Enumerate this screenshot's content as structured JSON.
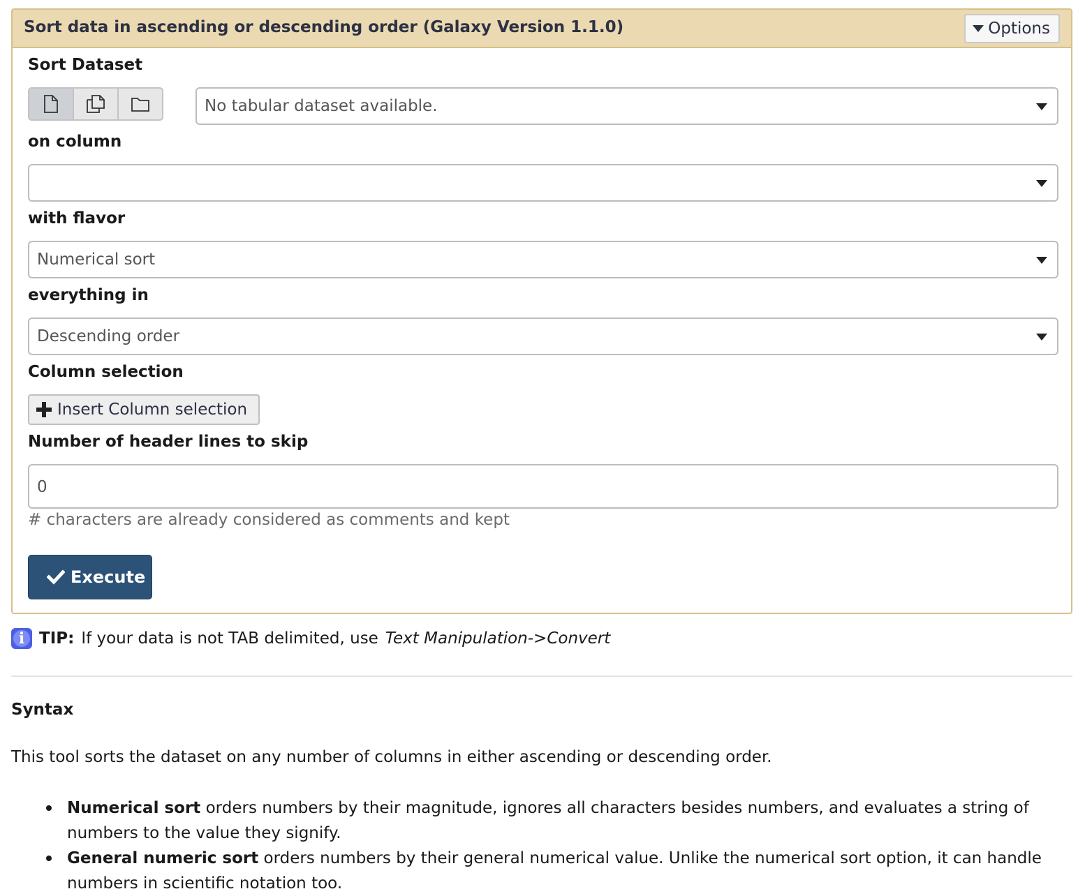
{
  "tool": {
    "title": "Sort data in ascending or descending order (Galaxy Version 1.1.0)",
    "options_label": "Options"
  },
  "form": {
    "sort_dataset": {
      "label": "Sort Dataset",
      "value": "No tabular dataset available.",
      "modes": [
        "single-dataset-icon",
        "multiple-datasets-icon",
        "dataset-collection-icon"
      ],
      "active_mode": "single-dataset-icon"
    },
    "on_column": {
      "label": "on column",
      "value": ""
    },
    "with_flavor": {
      "label": "with flavor",
      "value": "Numerical sort"
    },
    "everything_in": {
      "label": "everything in",
      "value": "Descending order"
    },
    "column_selection": {
      "label": "Column selection",
      "insert_label": "Insert Column selection"
    },
    "header_lines": {
      "label": "Number of header lines to skip",
      "value": "0",
      "help": "# characters are already considered as comments and kept"
    },
    "execute_label": "Execute"
  },
  "help": {
    "tip_label": "TIP:",
    "tip_text": "If your data is not TAB delimited, use",
    "tip_italic": "Text Manipulation->Convert",
    "syntax_heading": "Syntax",
    "intro": "This tool sorts the dataset on any number of columns in either ascending or descending order.",
    "bullets": [
      {
        "term": "Numerical sort",
        "text": " orders numbers by their magnitude, ignores all characters besides numbers, and evaluates a string of numbers to the value they signify."
      },
      {
        "term": "General numeric sort",
        "text": " orders numbers by their general numerical value. Unlike the numerical sort option, it can handle numbers in scientific notation too."
      }
    ]
  },
  "colors": {
    "header_bg": "#ebd9b2",
    "panel_border": "#d7c08b",
    "execute_bg": "#2c5278",
    "info_icon": "#4b5ee6"
  }
}
